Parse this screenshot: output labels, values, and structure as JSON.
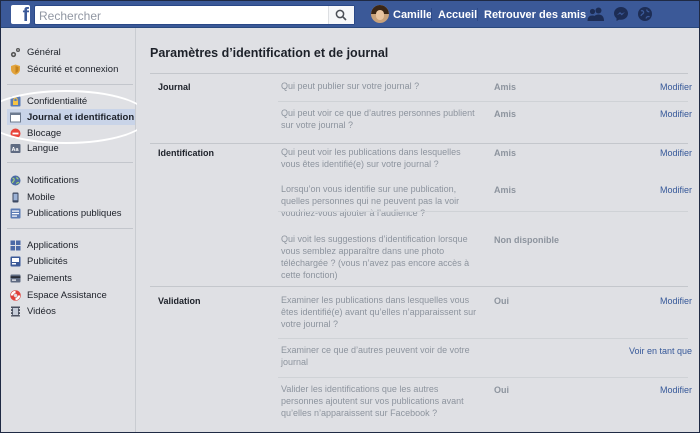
{
  "topbar": {
    "logo_letter": "f",
    "search_placeholder": "Rechercher",
    "user_name": "Camille",
    "home_label": "Accueil",
    "find_friends_label": "Retrouver des amis",
    "icons": [
      "friends-icon",
      "messenger-icon",
      "notifications-globe-icon"
    ]
  },
  "sidebar": {
    "groups": [
      [
        {
          "label": "Général",
          "icon": "gear-icon"
        },
        {
          "label": "Sécurité et connexion",
          "icon": "shield-icon"
        }
      ],
      [
        {
          "label": "Confidentialité",
          "icon": "lock-icon"
        },
        {
          "label": "Journal et identification",
          "icon": "timeline-icon",
          "active": true
        },
        {
          "label": "Blocage",
          "icon": "block-icon"
        },
        {
          "label": "Langue",
          "icon": "language-icon"
        }
      ],
      [
        {
          "label": "Notifications",
          "icon": "globe-icon"
        },
        {
          "label": "Mobile",
          "icon": "mobile-icon"
        },
        {
          "label": "Publications publiques",
          "icon": "rss-icon"
        }
      ],
      [
        {
          "label": "Applications",
          "icon": "apps-icon"
        },
        {
          "label": "Publicités",
          "icon": "ads-icon"
        },
        {
          "label": "Paiements",
          "icon": "payment-card-icon"
        },
        {
          "label": "Espace Assistance",
          "icon": "lifebuoy-icon"
        },
        {
          "label": "Vidéos",
          "icon": "video-icon"
        }
      ]
    ]
  },
  "main": {
    "title": "Paramètres d’identification et de journal",
    "sections": [
      {
        "name": "Journal",
        "rows": [
          {
            "question": "Qui peut publier sur votre journal ?",
            "value": "Amis",
            "action": "Modifier"
          },
          {
            "question": "Qui peut voir ce que d’autres personnes publient sur votre journal ?",
            "value": "Amis",
            "action": "Modifier"
          }
        ]
      },
      {
        "name": "Identification",
        "rows": [
          {
            "question": "Qui peut voir les publications dans lesquelles vous êtes identifié(e) sur votre journal ?",
            "value": "Amis",
            "action": "Modifier"
          },
          {
            "question": "Lorsqu’on vous identifie sur une publication, quelles personnes qui ne peuvent pas la voir voudriez-vous ajouter à l’audience ?",
            "value": "Amis",
            "action": "Modifier"
          },
          {
            "question": "Qui voit les suggestions d’identification lorsque vous semblez apparaître dans une photo téléchargée ? (vous n’avez pas encore accès à cette fonction)",
            "value": "Non disponible",
            "action": ""
          }
        ]
      },
      {
        "name": "Validation",
        "rows": [
          {
            "question": "Examiner les publications dans lesquelles vous êtes identifié(e) avant qu’elles n’apparaissent sur votre journal ?",
            "value": "Oui",
            "action": "Modifier"
          },
          {
            "question": "Examiner ce que d’autres peuvent voir de votre journal",
            "value": "",
            "action": "Voir en tant que"
          },
          {
            "question": "Valider les identifications que les autres personnes ajoutent sur vos publications avant qu’elles n’apparaissent sur Facebook ?",
            "value": "Oui",
            "action": "Modifier"
          }
        ]
      }
    ]
  },
  "colors": {
    "topbar": "#3b5998",
    "link": "#365899",
    "background": "#dfe0e4",
    "muted_text": "#8d949e"
  }
}
